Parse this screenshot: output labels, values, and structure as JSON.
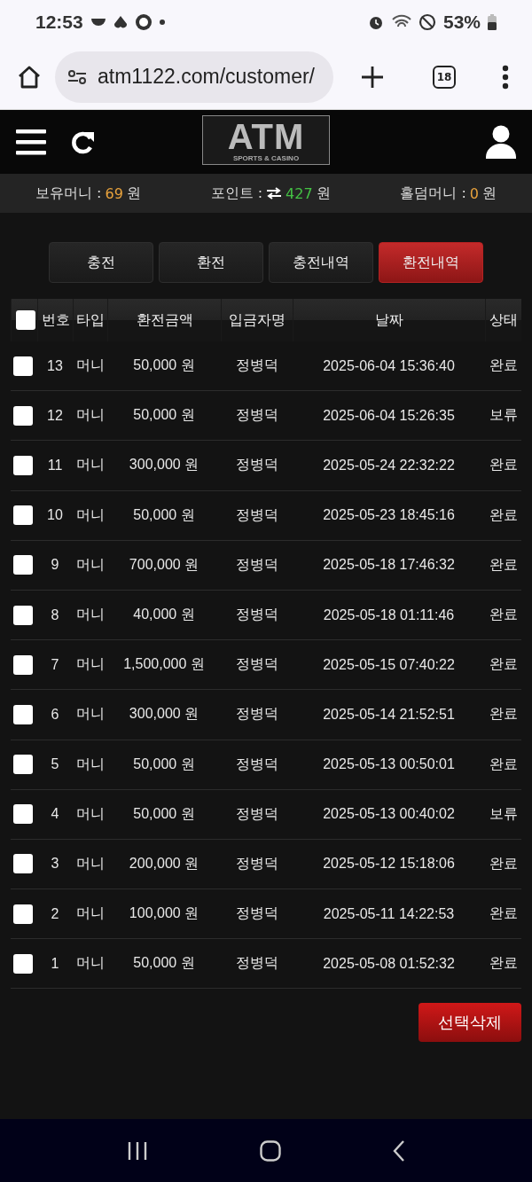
{
  "status_bar": {
    "time": "12:53",
    "battery": "53%"
  },
  "browser": {
    "url": "atm1122.com/customer/",
    "tab_count": "18"
  },
  "header": {
    "logo": "ATM",
    "logo_sub": "SPORTS & CASINO"
  },
  "balances": [
    {
      "label": "보유머니 :",
      "value": "69",
      "unit": "원",
      "kind": "money"
    },
    {
      "label": "포인트 :",
      "value": "427",
      "unit": "원",
      "kind": "point"
    },
    {
      "label": "홀덤머니 :",
      "value": "0",
      "unit": "원",
      "kind": "money"
    }
  ],
  "tabs": [
    {
      "label": "충전",
      "selected": false
    },
    {
      "label": "환전",
      "selected": false
    },
    {
      "label": "충전내역",
      "selected": false
    },
    {
      "label": "환전내역",
      "selected": true
    }
  ],
  "table": {
    "select_all_checked": false,
    "columns": [
      "번호",
      "타입",
      "환전금액",
      "입금자명",
      "날짜",
      "상태"
    ],
    "rows": [
      {
        "checked": false,
        "cells": [
          "13",
          "머니",
          "50,000 원",
          "정병덕",
          "2025-06-04 15:36:40",
          "완료"
        ]
      },
      {
        "checked": false,
        "cells": [
          "12",
          "머니",
          "50,000 원",
          "정병덕",
          "2025-06-04 15:26:35",
          "보류"
        ]
      },
      {
        "checked": false,
        "cells": [
          "11",
          "머니",
          "300,000 원",
          "정병덕",
          "2025-05-24 22:32:22",
          "완료"
        ]
      },
      {
        "checked": false,
        "cells": [
          "10",
          "머니",
          "50,000 원",
          "정병덕",
          "2025-05-23 18:45:16",
          "완료"
        ]
      },
      {
        "checked": false,
        "cells": [
          "9",
          "머니",
          "700,000 원",
          "정병덕",
          "2025-05-18 17:46:32",
          "완료"
        ]
      },
      {
        "checked": false,
        "cells": [
          "8",
          "머니",
          "40,000 원",
          "정병덕",
          "2025-05-18 01:11:46",
          "완료"
        ]
      },
      {
        "checked": false,
        "cells": [
          "7",
          "머니",
          "1,500,000 원",
          "정병덕",
          "2025-05-15 07:40:22",
          "완료"
        ]
      },
      {
        "checked": false,
        "cells": [
          "6",
          "머니",
          "300,000 원",
          "정병덕",
          "2025-05-14 21:52:51",
          "완료"
        ]
      },
      {
        "checked": false,
        "cells": [
          "5",
          "머니",
          "50,000 원",
          "정병덕",
          "2025-05-13 00:50:01",
          "완료"
        ]
      },
      {
        "checked": false,
        "cells": [
          "4",
          "머니",
          "50,000 원",
          "정병덕",
          "2025-05-13 00:40:02",
          "보류"
        ]
      },
      {
        "checked": false,
        "cells": [
          "3",
          "머니",
          "200,000 원",
          "정병덕",
          "2025-05-12 15:18:06",
          "완료"
        ]
      },
      {
        "checked": false,
        "cells": [
          "2",
          "머니",
          "100,000 원",
          "정병덕",
          "2025-05-11 14:22:53",
          "완료"
        ]
      },
      {
        "checked": false,
        "cells": [
          "1",
          "머니",
          "50,000 원",
          "정병덕",
          "2025-05-08 01:52:32",
          "완료"
        ]
      }
    ]
  },
  "delete_button": "선택삭제"
}
